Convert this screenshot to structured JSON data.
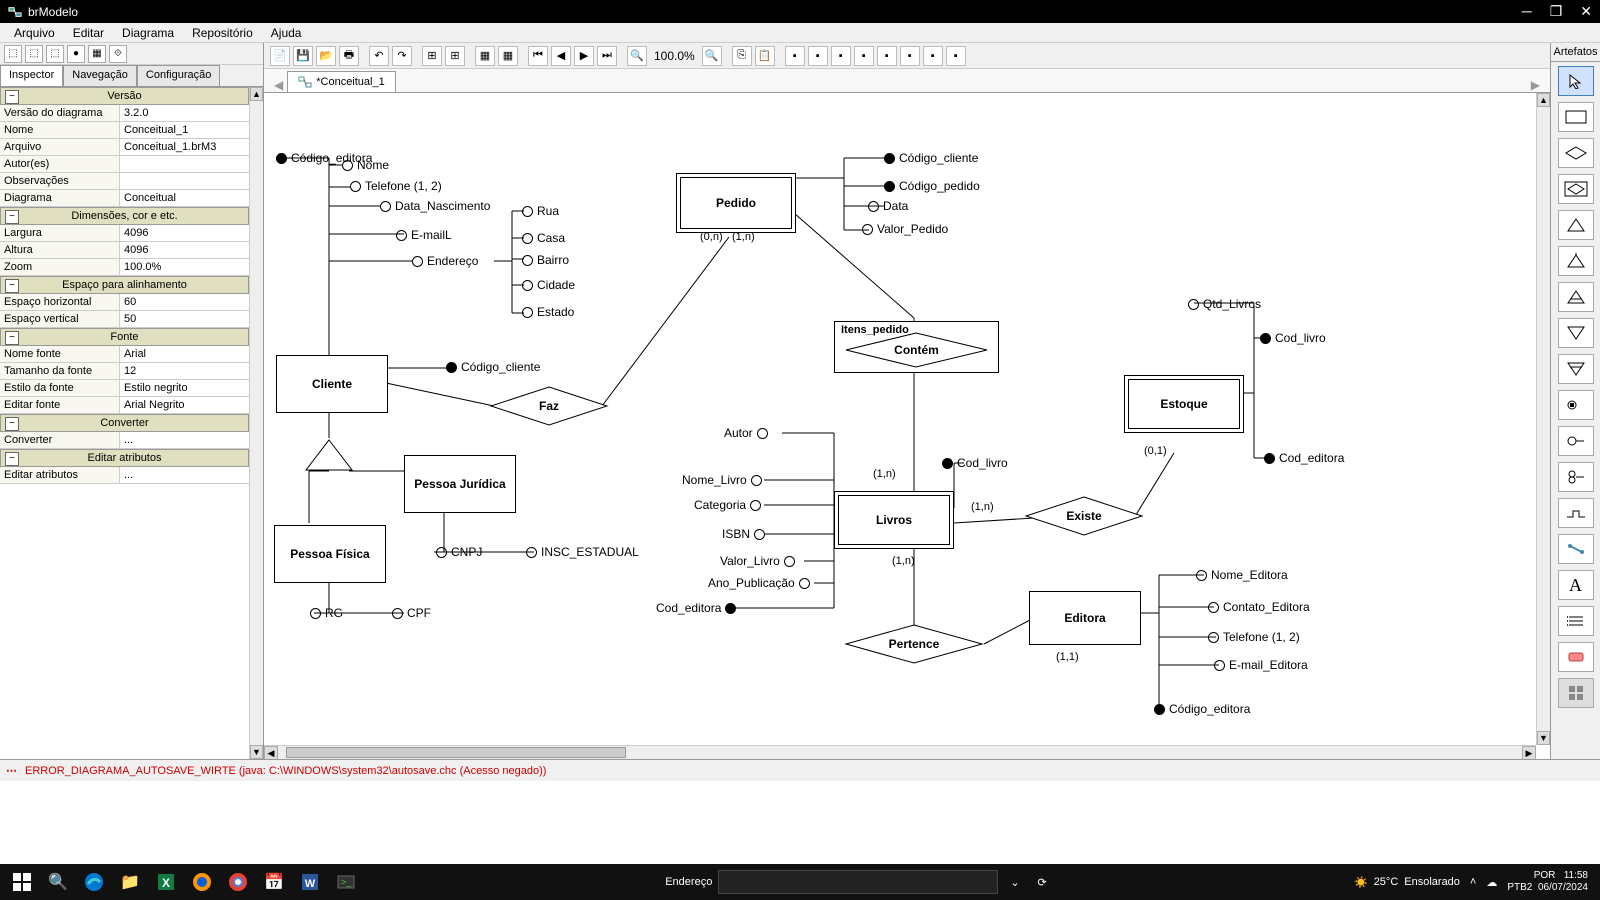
{
  "app": {
    "title": "brModelo"
  },
  "menu": [
    "Arquivo",
    "Editar",
    "Diagrama",
    "Repositório",
    "Ajuda"
  ],
  "left_tabs": [
    "Inspector",
    "Navegação",
    "Configuração"
  ],
  "sections": {
    "versao": "Versão",
    "dimensoes": "Dimensões, cor e etc.",
    "espaco": "Espaço para alinhamento",
    "fonte": "Fonte",
    "converter": "Converter",
    "editar_attr": "Editar atributos"
  },
  "props": {
    "versao_diagrama": {
      "k": "Versão do diagrama",
      "v": "3.2.0"
    },
    "nome": {
      "k": "Nome",
      "v": "Conceitual_1"
    },
    "arquivo": {
      "k": "Arquivo",
      "v": "Conceitual_1.brM3"
    },
    "autor": {
      "k": "Autor(es)",
      "v": ""
    },
    "obs": {
      "k": "Observações",
      "v": ""
    },
    "diagrama": {
      "k": "Diagrama",
      "v": "Conceitual"
    },
    "largura": {
      "k": "Largura",
      "v": "4096"
    },
    "altura": {
      "k": "Altura",
      "v": "4096"
    },
    "zoom": {
      "k": "Zoom",
      "v": "100.0%"
    },
    "esp_h": {
      "k": "Espaço horizontal",
      "v": "60"
    },
    "esp_v": {
      "k": "Espaço vertical",
      "v": "50"
    },
    "nome_fonte": {
      "k": "Nome fonte",
      "v": "Arial"
    },
    "tam_fonte": {
      "k": "Tamanho da fonte",
      "v": "12"
    },
    "estilo_fonte": {
      "k": "Estilo da fonte",
      "v": "Estilo negrito"
    },
    "editar_fonte": {
      "k": "Editar fonte",
      "v": "Arial Negrito"
    },
    "converter": {
      "k": "Converter",
      "v": "..."
    },
    "editar_attr": {
      "k": "Editar atributos",
      "v": "..."
    }
  },
  "zoom_display": "100.0%",
  "doc_tab": "*Conceitual_1",
  "palette_title": "Artefatos",
  "entities": {
    "pedido": "Pedido",
    "cliente": "Cliente",
    "pessoa_fisica": "Pessoa Física",
    "pessoa_juridica": "Pessoa Jurídica",
    "itens_pedido": "Itens_pedido",
    "livros": "Livros",
    "estoque": "Estoque",
    "editora": "Editora"
  },
  "relations": {
    "contem": "Contém",
    "faz": "Faz",
    "existe": "Existe",
    "pertence": "Pertence"
  },
  "attrs": {
    "codigo_editora_top": "Código_editora",
    "nome": "Nome",
    "telefone12": "Telefone (1, 2)",
    "data_nasc": "Data_Nascimento",
    "email": "E-mailL",
    "endereco": "Endereço",
    "rua": "Rua",
    "casa": "Casa",
    "bairro": "Bairro",
    "cidade": "Cidade",
    "estado": "Estado",
    "codigo_cliente": "Código_cliente",
    "codigo_cliente2": "Código_cliente",
    "codigo_pedido": "Código_pedido",
    "data": "Data",
    "valor_pedido": "Valor_Pedido",
    "rg": "RG",
    "cpf": "CPF",
    "cnpj": "CNPJ",
    "insc_estadual": "INSC_ESTADUAL",
    "autor": "Autor",
    "nome_livro": "Nome_Livro",
    "categoria": "Categoria",
    "isbn": "ISBN",
    "valor_livro": "Valor_Livro",
    "ano_pub": "Ano_Publicação",
    "cod_editora": "Cod_editora",
    "cod_livro": "Cod_livro",
    "qtd_livros": "Qtd_Livros",
    "cod_livro2": "Cod_livro",
    "cod_editora2": "Cod_editora",
    "nome_editora": "Nome_Editora",
    "contato_editora": "Contato_Editora",
    "telefone12b": "Telefone (1, 2)",
    "email_editora": "E-mail_Editora",
    "codigo_editora2": "Código_editora"
  },
  "cards": {
    "c0n": "(0,n)",
    "c1n": "(1,n)",
    "c1na": "(1,n)",
    "c1nb": "(1,n)",
    "c1nc": "(1,n)",
    "c01": "(0,1)",
    "c11": "(1,1)"
  },
  "status": {
    "error": "ERROR_DIAGRAMA_AUTOSAVE_WIRTE (java: C:\\WINDOWS\\system32\\autosave.chc (Acesso negado))"
  },
  "taskbar": {
    "addr_label": "Endereço",
    "weather_temp": "25°C",
    "weather_desc": "Ensolarado",
    "lang1": "POR",
    "lang2": "PTB2",
    "time": "11:58",
    "date": "06/07/2024"
  }
}
